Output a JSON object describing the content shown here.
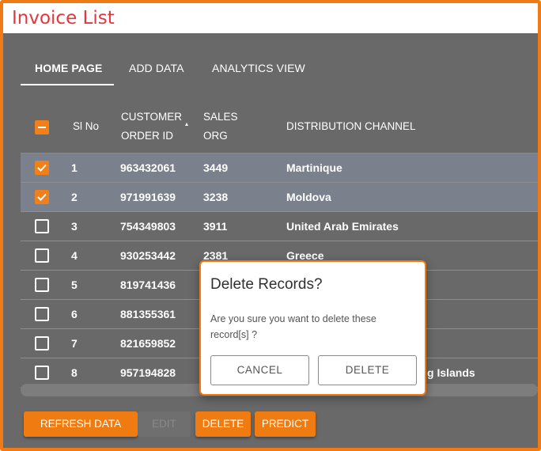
{
  "app": {
    "title": "Invoice List"
  },
  "tabs": [
    {
      "label": "HOME PAGE",
      "active": true
    },
    {
      "label": "ADD DATA",
      "active": false
    },
    {
      "label": "ANALYTICS VIEW",
      "active": false
    }
  ],
  "table": {
    "headers": {
      "sl_no": "Sl No",
      "customer_order_id_line1": "CUSTOMER",
      "customer_order_id_line2": "ORDER ID",
      "sales_org_line1": "SALES",
      "sales_org_line2": "ORG",
      "distribution_channel": "DISTRIBUTION CHANNEL"
    },
    "rows": [
      {
        "sl": "1",
        "order_id": "963432061",
        "sales_org": "3449",
        "channel": "Martinique",
        "checked": true
      },
      {
        "sl": "2",
        "order_id": "971991639",
        "sales_org": "3238",
        "channel": "Moldova",
        "checked": true
      },
      {
        "sl": "3",
        "order_id": "754349803",
        "sales_org": "3911",
        "channel": "United Arab Emirates",
        "checked": false
      },
      {
        "sl": "4",
        "order_id": "930253442",
        "sales_org": "2381",
        "channel": "Greece",
        "checked": false
      },
      {
        "sl": "5",
        "order_id": "819741436",
        "sales_org": "",
        "channel": "",
        "checked": false
      },
      {
        "sl": "6",
        "order_id": "881355361",
        "sales_org": "",
        "channel": "",
        "checked": false
      },
      {
        "sl": "7",
        "order_id": "821659852",
        "sales_org": "",
        "channel": "",
        "checked": false
      },
      {
        "sl": "8",
        "order_id": "957194828",
        "sales_org": "",
        "channel": "g Islands",
        "checked": false
      }
    ]
  },
  "buttons": {
    "refresh": "REFRESH DATA",
    "edit": "EDIT",
    "delete": "DELETE",
    "predict": "PREDICT"
  },
  "dialog": {
    "title": "Delete Records?",
    "message": "Are you sure you want to delete these record[s] ?",
    "cancel": "CANCEL",
    "confirm": "DELETE"
  },
  "colors": {
    "accent": "#f07a13",
    "title": "#e4363f",
    "panel": "#696969",
    "selected_row": "#7a818c"
  },
  "icons": {
    "checked": "checkbox-checked-icon",
    "unchecked": "checkbox-unchecked-icon",
    "indeterminate": "checkbox-indeterminate-icon",
    "sort": "sort-arrow-icon"
  }
}
